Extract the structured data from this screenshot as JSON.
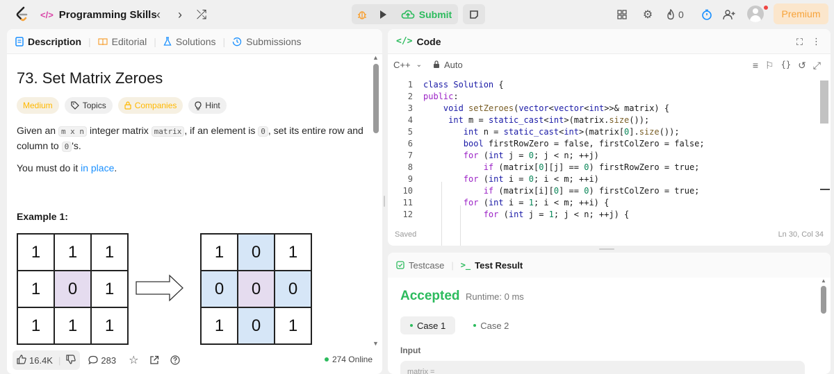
{
  "topbar": {
    "list_title": "Programming Skills",
    "list_icon": "</>",
    "prev_icon": "‹",
    "next_icon": "›",
    "shuffle_icon": "⤮",
    "submit_label": "Submit",
    "streak_count": "0",
    "premium_label": "Premium"
  },
  "desc_tabs": [
    {
      "label": "Description"
    },
    {
      "label": "Editorial"
    },
    {
      "label": "Solutions"
    },
    {
      "label": "Submissions"
    }
  ],
  "problem": {
    "title": "73. Set Matrix Zeroes",
    "difficulty": "Medium",
    "topics_label": "Topics",
    "companies_label": "Companies",
    "hint_label": "Hint",
    "p1_a": "Given an ",
    "p1_code1": "m x n",
    "p1_b": " integer matrix ",
    "p1_code2": "matrix",
    "p1_c": ", if an element is ",
    "p1_code3": "0",
    "p1_d": ", set its entire row and column to ",
    "p1_code4": "0",
    "p1_e": "'s.",
    "p2_a": "You must do it ",
    "p2_link": "in place",
    "p2_b": ".",
    "example_title": "Example 1:",
    "input_matrix": [
      [
        "1",
        "1",
        "1"
      ],
      [
        "1",
        "0",
        "1"
      ],
      [
        "1",
        "1",
        "1"
      ]
    ],
    "output_matrix": [
      [
        "1",
        "0",
        "1"
      ],
      [
        "0",
        "0",
        "0"
      ],
      [
        "1",
        "0",
        "1"
      ]
    ]
  },
  "desc_bottom": {
    "likes": "16.4K",
    "comments": "283",
    "online": "274 Online"
  },
  "code_panel": {
    "title": "Code",
    "language": "C++",
    "mode": "Auto",
    "saved": "Saved",
    "cursor": "Ln 30, Col 34",
    "lines": [
      {
        "n": "1",
        "t": "class Solution {"
      },
      {
        "n": "2",
        "t": "public:"
      },
      {
        "n": "3",
        "t": "    void setZeroes(vector<vector<int>>& matrix) {"
      },
      {
        "n": "4",
        "t": "     int m = static_cast<int>(matrix.size());"
      },
      {
        "n": "5",
        "t": "        int n = static_cast<int>(matrix[0].size());"
      },
      {
        "n": "6",
        "t": "        bool firstRowZero = false, firstColZero = false;"
      },
      {
        "n": "7",
        "t": "        for (int j = 0; j < n; ++j)"
      },
      {
        "n": "8",
        "t": "            if (matrix[0][j] == 0) firstRowZero = true;"
      },
      {
        "n": "9",
        "t": "        for (int i = 0; i < m; ++i)"
      },
      {
        "n": "10",
        "t": "            if (matrix[i][0] == 0) firstColZero = true;"
      },
      {
        "n": "11",
        "t": "        for (int i = 1; i < m; ++i) {"
      },
      {
        "n": "12",
        "t": "            for (int j = 1; j < n; ++j) {"
      }
    ]
  },
  "result_panel": {
    "tab_testcase": "Testcase",
    "tab_result": "Test Result",
    "status": "Accepted",
    "runtime": "Runtime: 0 ms",
    "case1": "Case 1",
    "case2": "Case 2",
    "input_label": "Input",
    "input_preview": "matrix ="
  },
  "colors": {
    "accent_green": "#2cbb5d",
    "difficulty_medium": "#ffb800",
    "premium_text": "#f7a33a",
    "link": "#1a90ff"
  }
}
